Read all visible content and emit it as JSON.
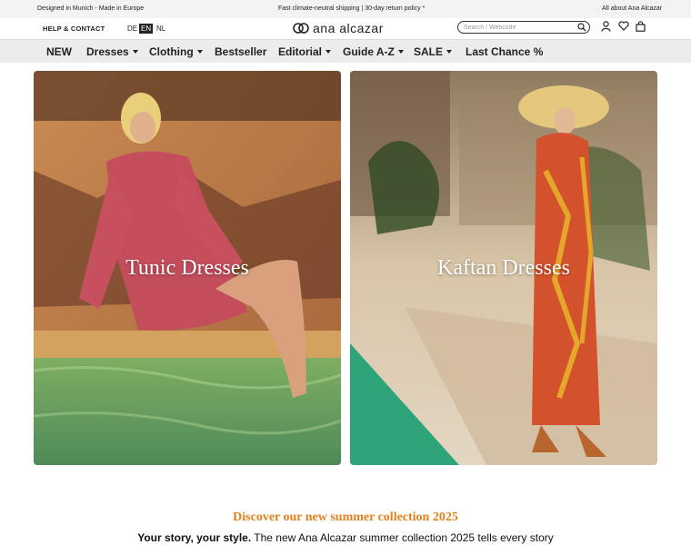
{
  "topbar": {
    "left": "Designed in Munich - Made in Europe",
    "center": "Fast climate-neutral shipping | 30-day return policy *",
    "right": "All about Ana Alcazar"
  },
  "header": {
    "help": "HELP & CONTACT",
    "languages": [
      "DE",
      "EN",
      "NL"
    ],
    "active_language": "EN",
    "logo": "ana alcazar",
    "search_placeholder": "Search / Webcode"
  },
  "nav": {
    "items": [
      "NEW",
      "Dresses",
      "Clothing",
      "Bestseller",
      "Editorial",
      "Guide A-Z",
      "SALE",
      "Last Chance %"
    ]
  },
  "cards": [
    {
      "title": "Tunic Dresses"
    },
    {
      "title": "Kaftan Dresses"
    }
  ],
  "promo": {
    "title": "Discover our new summer collection 2025",
    "lead": "Your story, your style.",
    "text": " The new Ana Alcazar summer collection 2025 tells every story"
  },
  "colors": {
    "accent": "#e2801c",
    "nav_bg": "#ececec",
    "topbar_bg": "#f3f3f3"
  }
}
